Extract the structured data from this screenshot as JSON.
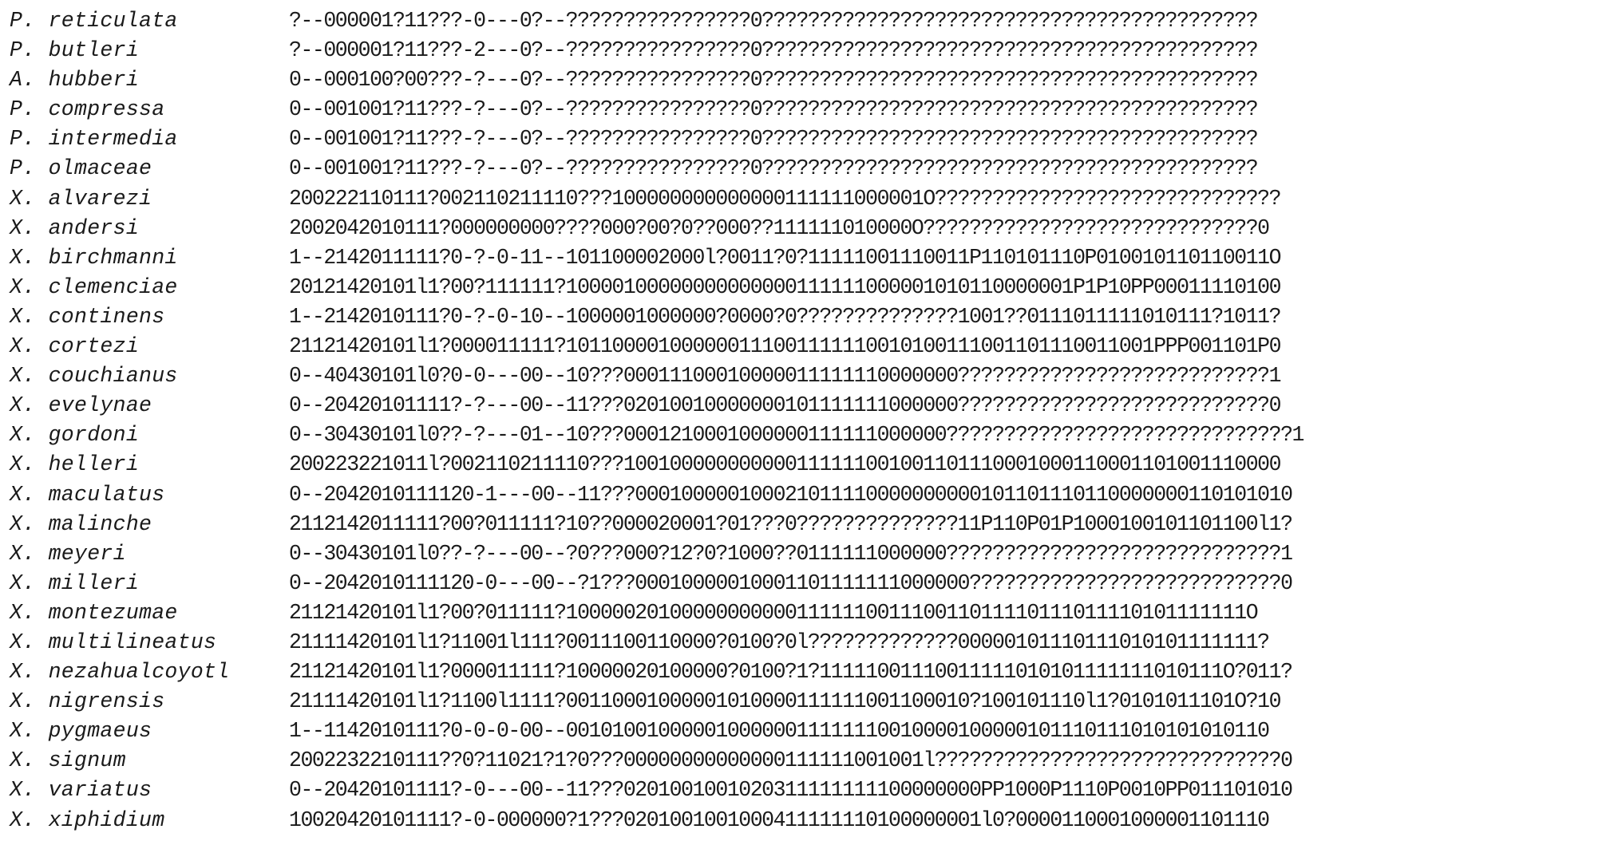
{
  "matrix": {
    "rows": [
      {
        "taxon": "P. reticulata",
        "codes": "?--000001?11???-0---0?--????????????????0???????????????????????????????????????????"
      },
      {
        "taxon": "P. butleri",
        "codes": "?--000001?11???-2---0?--????????????????0???????????????????????????????????????????"
      },
      {
        "taxon": "A. hubberi",
        "codes": "0--000100?00???-?---0?--????????????????0???????????????????????????????????????????"
      },
      {
        "taxon": "P. compressa",
        "codes": "0--001001?11???-?---0?--????????????????0???????????????????????????????????????????"
      },
      {
        "taxon": "P. intermedia",
        "codes": "0--001001?11???-?---0?--????????????????0???????????????????????????????????????????"
      },
      {
        "taxon": "P. olmaceae",
        "codes": "0--001001?11???-?---0?--????????????????0???????????????????????????????????????????"
      },
      {
        "taxon": "X. alvarezi",
        "codes": "200222110111?002110211110???100000000000000111111000001O??????????????????????????????"
      },
      {
        "taxon": "X. andersi",
        "codes": "2002042010111?000000000????000?00?0??000??111111010000O?????????????????????????????0"
      },
      {
        "taxon": "X. birchmanni",
        "codes": "1--2142011111?0-?-0-11--101100002000l?0011?0?11111001110011P110101110P010010110110011O"
      },
      {
        "taxon": "X. clemenciae",
        "codes": "20121420101l1?00?111111?10000100000000000000111111000001010110000001P1P10PP00011110100"
      },
      {
        "taxon": "X. continens",
        "codes": "1--2142010111?0-?-0-10--1000001000000?0000?0??????????????1001??0111011111010111?1011?"
      },
      {
        "taxon": "X. cortezi",
        "codes": "21121420101l1?000011111?101100001000000111001111110010100111001101110011001PPP001101P0"
      },
      {
        "taxon": "X. couchianus",
        "codes": "0--40430101l0?0-0---00--10???00011100010000011111110000000???????????????????????????1"
      },
      {
        "taxon": "X. evelynae",
        "codes": "0--20420101111?-?---00--11???02010010000000101111111000000???????????????????????????0"
      },
      {
        "taxon": "X. gordoni",
        "codes": "0--30430101l0??-?---01--10???0001210001000000111111000000??????????????????????????????1"
      },
      {
        "taxon": "X. helleri",
        "codes": "200223221011l?002110211110???100100000000000111111001001101110001000110001101001110000"
      },
      {
        "taxon": "X. maculatus",
        "codes": "0--2042010111120-1---00--11???000100000100021011110000000000101101110110000000110101010"
      },
      {
        "taxon": "X. malinche",
        "codes": "2112142011111?00?011111?10??000020001?01???0??????????????11P110P01P1000100101101100l1?"
      },
      {
        "taxon": "X. meyeri",
        "codes": "0--30430101l0??-?---00--?0???000?12?0?1000??0111111000000?????????????????????????????1"
      },
      {
        "taxon": "X. milleri",
        "codes": "0--2042010111120-0---00--?1???00010000010001101111111000000???????????????????????????0"
      },
      {
        "taxon": "X. montezumae",
        "codes": "21121420101l1?00?011111?10000020100000000000111111001110011011110111011110101111111O"
      },
      {
        "taxon": "X. multilineatus",
        "codes": "21111420101l1?11001l111?0011100110000?0100?0l?????????????00000101110111010101111111?"
      },
      {
        "taxon": "X. nezahualcoyotl",
        "codes": "21121420101l1?000011111?10000020100000?0100?1?11111001110011111010101111111010111O?011?"
      },
      {
        "taxon": "X. nigrensis",
        "codes": "21111420101l1?1100l1111?00110001000001010000111111001100010?100101110l1?0101011101O?10"
      },
      {
        "taxon": "X. pygmaeus",
        "codes": "1--1142010111?0-0-0-00--0010100100000100000011111110010000100000101110111010101010110"
      },
      {
        "taxon": "X. signum",
        "codes": "2002232210111??0?11021?1?0???00000000000000111111001001l??????????????????????????????0"
      },
      {
        "taxon": "X. variatus",
        "codes": "0--20420101111?-0---00--11???0201001001020311111111100000000PP1000P1110P0010PP011101010"
      },
      {
        "taxon": "X. xiphidium",
        "codes": "10020420101111?-0-000000?1???0201001001000411111110100000001l0?0000110001000001101110"
      }
    ]
  }
}
